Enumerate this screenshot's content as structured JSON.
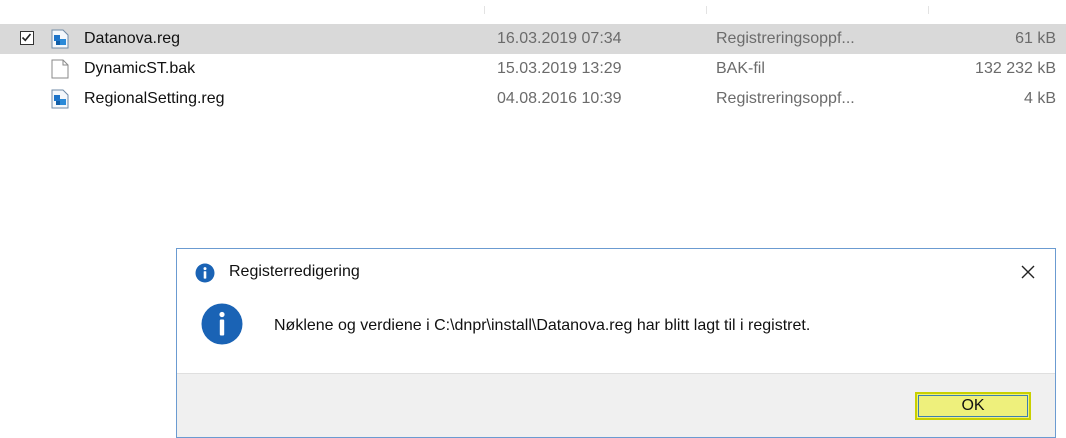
{
  "files": [
    {
      "name": "Datanova.reg",
      "date": "16.03.2019 07:34",
      "type": "Registreringsoppf...",
      "size": "61 kB",
      "icon": "reg-file-icon",
      "selected": true,
      "checked": true
    },
    {
      "name": "DynamicST.bak",
      "date": "15.03.2019 13:29",
      "type": "BAK-fil",
      "size": "132 232 kB",
      "icon": "blank-file-icon",
      "selected": false,
      "checked": false
    },
    {
      "name": "RegionalSetting.reg",
      "date": "04.08.2016 10:39",
      "type": "Registreringsoppf...",
      "size": "4 kB",
      "icon": "reg-file-icon",
      "selected": false,
      "checked": false
    }
  ],
  "dialog": {
    "title": "Registerredigering",
    "message": "Nøklene og verdiene i C:\\dnpr\\install\\Datanova.reg har blitt lagt til i registret.",
    "ok_label": "OK",
    "icon": "info-icon",
    "colors": {
      "info_blue": "#1a63b5",
      "ok_highlight": "#eef07c",
      "border": "#6b9bd1"
    }
  }
}
